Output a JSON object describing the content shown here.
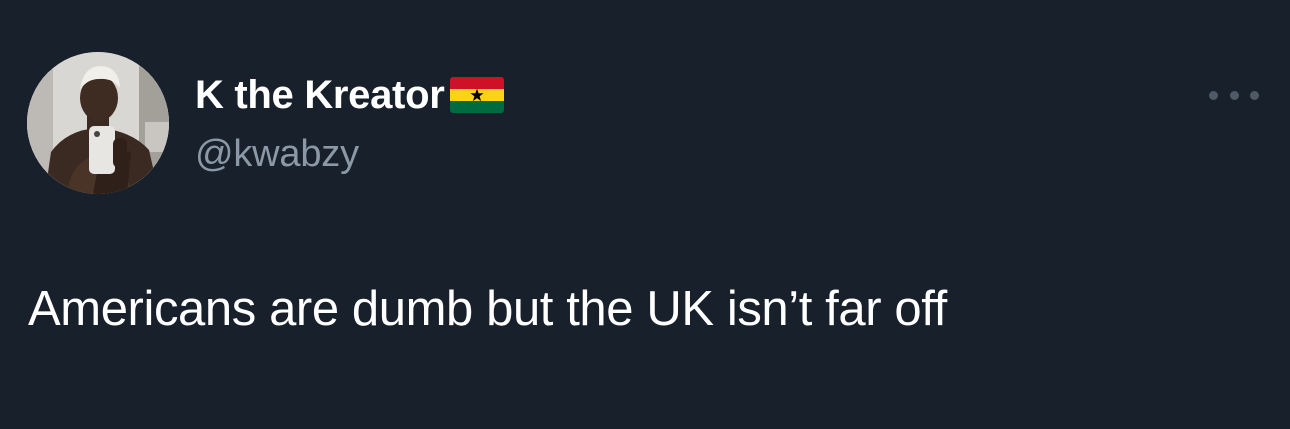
{
  "author": {
    "display_name": "K the Kreator",
    "handle": "@kwabzy",
    "flag_emoji": "ghana-flag-icon",
    "avatar_icon": "profile-photo-icon"
  },
  "menu": {
    "icon": "more-options-icon"
  },
  "tweet": {
    "text": "Americans are dumb but the UK isn’t far off"
  },
  "colors": {
    "background": "#17202b",
    "name": "#ffffff",
    "handle": "#8b98a5",
    "text": "#ffffff",
    "menu_dots": "#4e5a66"
  }
}
